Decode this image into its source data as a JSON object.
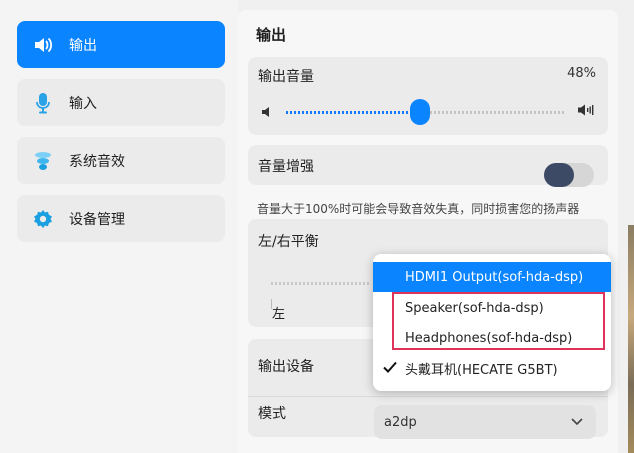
{
  "sidebar": {
    "items": [
      {
        "label": "输出",
        "icon": "speaker-icon",
        "active": true
      },
      {
        "label": "输入",
        "icon": "microphone-icon",
        "active": false
      },
      {
        "label": "系统音效",
        "icon": "sound-effects-icon",
        "active": false
      },
      {
        "label": "设备管理",
        "icon": "gear-icon",
        "active": false
      }
    ]
  },
  "main": {
    "title": "输出",
    "volume": {
      "label": "输出音量",
      "value_text": "48%",
      "level": 0.48
    },
    "boost": {
      "label": "音量增强",
      "enabled": false,
      "note": "音量大于100%时可能会导致音效失真，同时损害您的扬声器"
    },
    "balance": {
      "label": "左/右平衡",
      "left_label": "左"
    },
    "device": {
      "label": "输出设备"
    },
    "mode": {
      "label": "模式",
      "value": "a2dp"
    }
  },
  "dropdown": {
    "options": [
      {
        "label": "HDMI1 Output(sof-hda-dsp)",
        "highlighted": true,
        "checked": false
      },
      {
        "label": "Speaker(sof-hda-dsp)",
        "highlighted": false,
        "checked": false
      },
      {
        "label": "Headphones(sof-hda-dsp)",
        "highlighted": false,
        "checked": false
      },
      {
        "label": "头戴耳机(HECATE G5BT)",
        "highlighted": false,
        "checked": true
      }
    ]
  },
  "colors": {
    "accent": "#0a84ff",
    "toggle_knob": "#3c4a66",
    "annotation": "#e0325a"
  }
}
